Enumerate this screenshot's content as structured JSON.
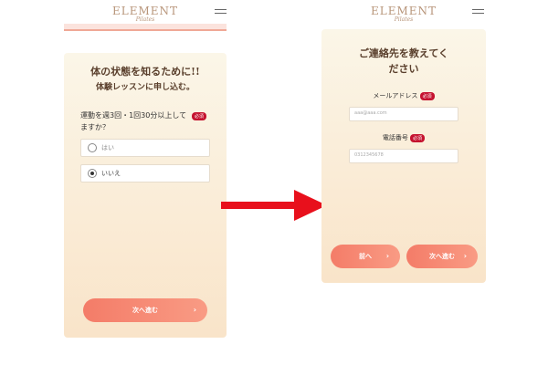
{
  "brand": {
    "logo": "ELEMENT",
    "logo_sub": "Pilates"
  },
  "left_screen": {
    "heading_line1": "体の状態を知るために!!",
    "heading_line2": "体験レッスンに申し込む。",
    "question": "運動を週3回・1回30分以上してますか？",
    "required_badge": "必須",
    "options": [
      {
        "label": "はい",
        "selected": false
      },
      {
        "label": "いいえ",
        "selected": true
      }
    ],
    "next_button": "次へ進む"
  },
  "right_screen": {
    "heading_line1": "ご連絡先を教えてく",
    "heading_line2": "ださい",
    "email_label": "メールアドレス",
    "email_placeholder": "aaa@aaa.com",
    "phone_label": "電話番号",
    "phone_placeholder": "0312345678",
    "required_badge": "必須",
    "back_button": "前へ",
    "next_button": "次へ進む"
  },
  "colors": {
    "accent": "#f47c68",
    "required": "#c5122f",
    "heading": "#5a3f2c",
    "arrow": "#e8101c"
  },
  "icons": {
    "menu": "hamburger-icon",
    "arrow": "right-arrow-icon",
    "chevron": "chevron-right-icon"
  }
}
